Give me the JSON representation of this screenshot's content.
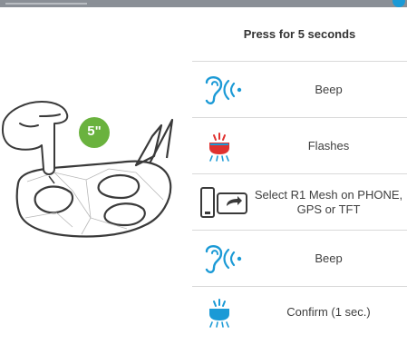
{
  "panel": {
    "title": "Press for 5 seconds",
    "rows": [
      {
        "icon": "ear-sound-icon",
        "label": "Beep"
      },
      {
        "icon": "led-flash-icon",
        "label": "Flashes"
      },
      {
        "icon": "phone-screen-icon",
        "label": "Select R1 Mesh on PHONE, GPS or TFT"
      },
      {
        "icon": "ear-sound-icon",
        "label": "Beep"
      },
      {
        "icon": "led-flash-icon",
        "label": "Confirm (1 sec.)"
      }
    ]
  },
  "illustration": {
    "badge_text": "5\""
  },
  "colors": {
    "accent_blue": "#1b9ad6",
    "led_red": "#e0312f",
    "badge_green": "#6ab23e"
  }
}
